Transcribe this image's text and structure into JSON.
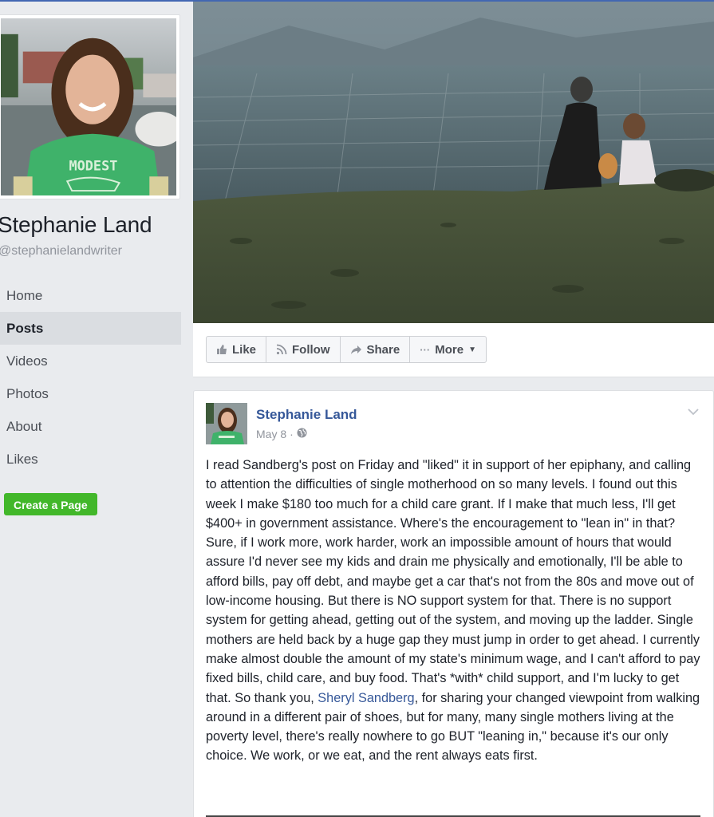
{
  "page": {
    "name": "Stephanie Land",
    "handle": "@stephanielandwriter",
    "profile_shirt_text": "MODEST"
  },
  "nav": {
    "items": [
      {
        "label": "Home"
      },
      {
        "label": "Posts"
      },
      {
        "label": "Videos"
      },
      {
        "label": "Photos"
      },
      {
        "label": "About"
      },
      {
        "label": "Likes"
      }
    ],
    "active": "Posts",
    "create_page": "Create a Page"
  },
  "actions": {
    "like": "Like",
    "follow": "Follow",
    "share": "Share",
    "more": "More"
  },
  "post": {
    "author": "Stephanie Land",
    "date": "May 8",
    "separator": "·",
    "text_part1": "I read Sandberg's post on Friday and \"liked\" it in support of her epiphany, and calling to attention the difficulties of single motherhood on so many levels. I found out this week I make $180 too much for a child care grant. If I make that much less, I'll get $400+ in government assistance. Where's the encouragement to \"lean in\" in that? Sure, if I work more, work harder, work an impossible amount of hours that would assure I'd never see my kids and drain me physically and emotionally, I'll be able to afford bills, pay off debt, and maybe get a car that's not from the 80s and move out of low-income housing. But there is NO support system for that. There is no support system for getting ahead, getting out of the system, and moving up the ladder. Single mothers are held back by a huge gap they must jump in order to get ahead. I currently make almost double the amount of my state's minimum wage, and I can't afford to pay fixed bills, child care, and buy food. That's *with* child support, and I'm lucky to get that. So thank you, ",
    "mention": "Sheryl Sandberg",
    "text_part2": ", for sharing your changed viewpoint from walking around in a different pair of shoes, but for many, many single mothers living at the poverty level, there's really nowhere to go BUT \"leaning in,\" because it's our only choice. We work, or we eat, and the rent always eats first."
  },
  "colors": {
    "link": "#365899",
    "create_button": "#42b72a",
    "background": "#e9ebee"
  }
}
